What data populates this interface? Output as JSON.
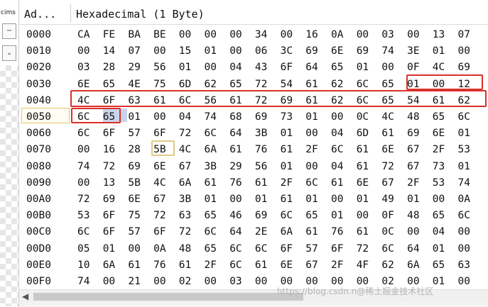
{
  "left_tab": {
    "label": "cims",
    "minimize_icon": "−",
    "chevron_icon": "⌄"
  },
  "header": {
    "address_label": "Ad...",
    "hex_label": "Hexadecimal (1 Byte)"
  },
  "rows": [
    {
      "addr": "0000",
      "bytes": [
        "CA",
        "FE",
        "BA",
        "BE",
        "00",
        "00",
        "00",
        "34",
        "00",
        "16",
        "0A",
        "00",
        "03",
        "00",
        "13",
        "07"
      ]
    },
    {
      "addr": "0010",
      "bytes": [
        "00",
        "14",
        "07",
        "00",
        "15",
        "01",
        "00",
        "06",
        "3C",
        "69",
        "6E",
        "69",
        "74",
        "3E",
        "01",
        "00"
      ]
    },
    {
      "addr": "0020",
      "bytes": [
        "03",
        "28",
        "29",
        "56",
        "01",
        "00",
        "04",
        "43",
        "6F",
        "64",
        "65",
        "01",
        "00",
        "0F",
        "4C",
        "69"
      ]
    },
    {
      "addr": "0030",
      "bytes": [
        "6E",
        "65",
        "4E",
        "75",
        "6D",
        "62",
        "65",
        "72",
        "54",
        "61",
        "62",
        "6C",
        "65",
        "01",
        "00",
        "12"
      ]
    },
    {
      "addr": "0040",
      "bytes": [
        "4C",
        "6F",
        "63",
        "61",
        "6C",
        "56",
        "61",
        "72",
        "69",
        "61",
        "62",
        "6C",
        "65",
        "54",
        "61",
        "62"
      ]
    },
    {
      "addr": "0050",
      "bytes": [
        "6C",
        "65",
        "01",
        "00",
        "04",
        "74",
        "68",
        "69",
        "73",
        "01",
        "00",
        "0C",
        "4C",
        "48",
        "65",
        "6C"
      ]
    },
    {
      "addr": "0060",
      "bytes": [
        "6C",
        "6F",
        "57",
        "6F",
        "72",
        "6C",
        "64",
        "3B",
        "01",
        "00",
        "04",
        "6D",
        "61",
        "69",
        "6E",
        "01"
      ]
    },
    {
      "addr": "0070",
      "bytes": [
        "00",
        "16",
        "28",
        "5B",
        "4C",
        "6A",
        "61",
        "76",
        "61",
        "2F",
        "6C",
        "61",
        "6E",
        "67",
        "2F",
        "53"
      ]
    },
    {
      "addr": "0080",
      "bytes": [
        "74",
        "72",
        "69",
        "6E",
        "67",
        "3B",
        "29",
        "56",
        "01",
        "00",
        "04",
        "61",
        "72",
        "67",
        "73",
        "01"
      ]
    },
    {
      "addr": "0090",
      "bytes": [
        "00",
        "13",
        "5B",
        "4C",
        "6A",
        "61",
        "76",
        "61",
        "2F",
        "6C",
        "61",
        "6E",
        "67",
        "2F",
        "53",
        "74"
      ]
    },
    {
      "addr": "00A0",
      "bytes": [
        "72",
        "69",
        "6E",
        "67",
        "3B",
        "01",
        "00",
        "01",
        "61",
        "01",
        "00",
        "01",
        "49",
        "01",
        "00",
        "0A"
      ]
    },
    {
      "addr": "00B0",
      "bytes": [
        "53",
        "6F",
        "75",
        "72",
        "63",
        "65",
        "46",
        "69",
        "6C",
        "65",
        "01",
        "00",
        "0F",
        "48",
        "65",
        "6C"
      ]
    },
    {
      "addr": "00C0",
      "bytes": [
        "6C",
        "6F",
        "57",
        "6F",
        "72",
        "6C",
        "64",
        "2E",
        "6A",
        "61",
        "76",
        "61",
        "0C",
        "00",
        "04",
        "00"
      ]
    },
    {
      "addr": "00D0",
      "bytes": [
        "05",
        "01",
        "00",
        "0A",
        "48",
        "65",
        "6C",
        "6C",
        "6F",
        "57",
        "6F",
        "72",
        "6C",
        "64",
        "01",
        "00"
      ]
    },
    {
      "addr": "00E0",
      "bytes": [
        "10",
        "6A",
        "61",
        "76",
        "61",
        "2F",
        "6C",
        "61",
        "6E",
        "67",
        "2F",
        "4F",
        "62",
        "6A",
        "65",
        "63"
      ]
    },
    {
      "addr": "00F0",
      "bytes": [
        "74",
        "00",
        "21",
        "00",
        "02",
        "00",
        "03",
        "00",
        "00",
        "00",
        "00",
        "00",
        "02",
        "00",
        "01",
        "00"
      ]
    }
  ],
  "watermark": "https://blog.csdn.n@稀土掘金技术社区",
  "colors": {
    "highlight": "#d9312b",
    "selection": "#c9d4ea",
    "cursor": "#e2c98a"
  }
}
